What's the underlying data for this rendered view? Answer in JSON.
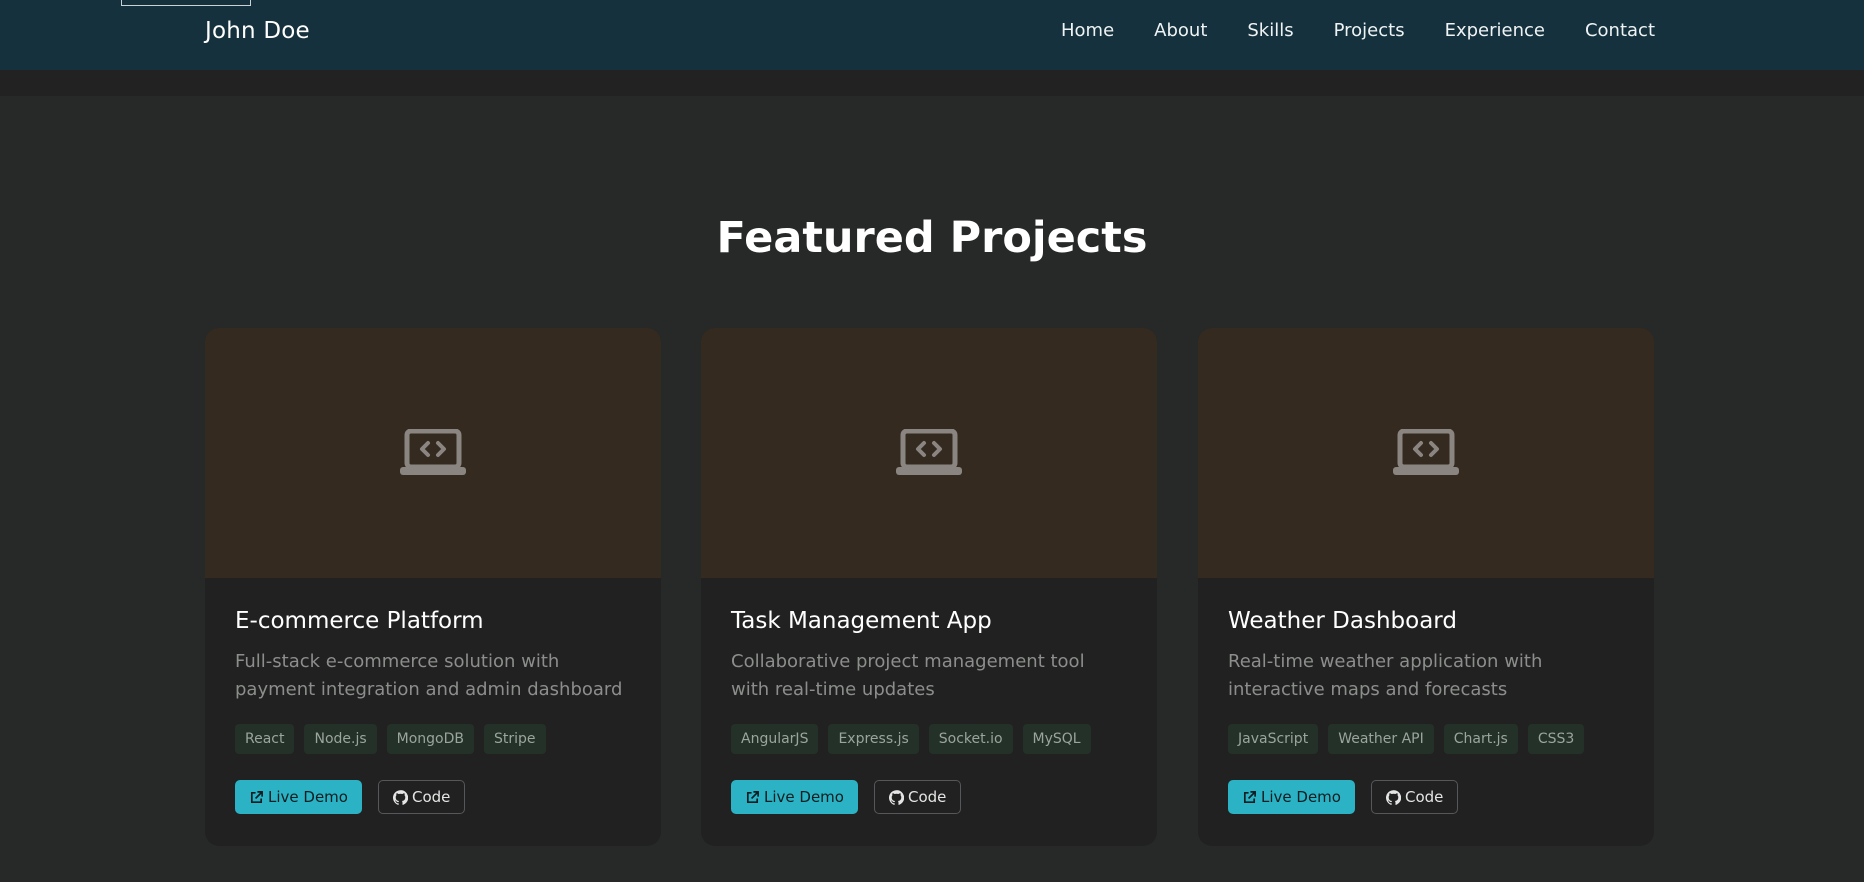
{
  "brand": "John Doe",
  "nav": {
    "links": [
      "Home",
      "About",
      "Skills",
      "Projects",
      "Experience",
      "Contact"
    ]
  },
  "section": {
    "title": "Featured Projects"
  },
  "projects": [
    {
      "title": "E-commerce Platform",
      "description": "Full-stack e-commerce solution with payment integration and admin dashboard",
      "tags": [
        "React",
        "Node.js",
        "MongoDB",
        "Stripe"
      ],
      "demo_label": "Live Demo",
      "code_label": "Code",
      "icon": "laptop-code-icon"
    },
    {
      "title": "Task Management App",
      "description": "Collaborative project management tool with real-time updates",
      "tags": [
        "AngularJS",
        "Express.js",
        "Socket.io",
        "MySQL"
      ],
      "demo_label": "Live Demo",
      "code_label": "Code",
      "icon": "laptop-code-icon"
    },
    {
      "title": "Weather Dashboard",
      "description": "Real-time weather application with interactive maps and forecasts",
      "tags": [
        "JavaScript",
        "Weather API",
        "Chart.js",
        "CSS3"
      ],
      "demo_label": "Live Demo",
      "code_label": "Code",
      "icon": "laptop-code-icon"
    }
  ],
  "colors": {
    "navbar": "#15313d",
    "page_background": "#272928",
    "card_background": "#202120",
    "card_media": "#342a20",
    "accent": "#2bb3c5",
    "tag_background": "#243128"
  }
}
